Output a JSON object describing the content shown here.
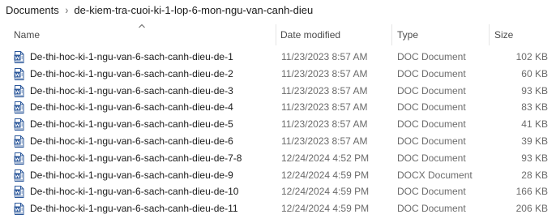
{
  "breadcrumb": {
    "items": [
      "Documents",
      "de-kiem-tra-cuoi-ki-1-lop-6-mon-ngu-van-canh-dieu"
    ],
    "separator": "›"
  },
  "columns": {
    "name": "Name",
    "date": "Date modified",
    "type": "Type",
    "size": "Size"
  },
  "colors": {
    "word_icon": "#2b579a"
  },
  "files": [
    {
      "name": "De-thi-hoc-ki-1-ngu-van-6-sach-canh-dieu-de-1",
      "date": "11/23/2023 8:57 AM",
      "type": "DOC Document",
      "size": "102 KB",
      "icon": "word-doc-icon"
    },
    {
      "name": "De-thi-hoc-ki-1-ngu-van-6-sach-canh-dieu-de-2",
      "date": "11/23/2023 8:57 AM",
      "type": "DOC Document",
      "size": "60 KB",
      "icon": "word-doc-icon"
    },
    {
      "name": "De-thi-hoc-ki-1-ngu-van-6-sach-canh-dieu-de-3",
      "date": "11/23/2023 8:57 AM",
      "type": "DOC Document",
      "size": "93 KB",
      "icon": "word-doc-icon"
    },
    {
      "name": "De-thi-hoc-ki-1-ngu-van-6-sach-canh-dieu-de-4",
      "date": "11/23/2023 8:57 AM",
      "type": "DOC Document",
      "size": "83 KB",
      "icon": "word-doc-icon"
    },
    {
      "name": "De-thi-hoc-ki-1-ngu-van-6-sach-canh-dieu-de-5",
      "date": "11/23/2023 8:57 AM",
      "type": "DOC Document",
      "size": "41 KB",
      "icon": "word-doc-icon"
    },
    {
      "name": "De-thi-hoc-ki-1-ngu-van-6-sach-canh-dieu-de-6",
      "date": "11/23/2023 8:57 AM",
      "type": "DOC Document",
      "size": "39 KB",
      "icon": "word-doc-icon"
    },
    {
      "name": "De-thi-hoc-ki-1-ngu-van-6-sach-canh-dieu-de-7-8",
      "date": "12/24/2024 4:52 PM",
      "type": "DOC Document",
      "size": "93 KB",
      "icon": "word-doc-icon"
    },
    {
      "name": "De-thi-hoc-ki-1-ngu-van-6-sach-canh-dieu-de-9",
      "date": "12/24/2024 4:59 PM",
      "type": "DOCX Document",
      "size": "28 KB",
      "icon": "word-docx-icon"
    },
    {
      "name": "De-thi-hoc-ki-1-ngu-van-6-sach-canh-dieu-de-10",
      "date": "12/24/2024 4:59 PM",
      "type": "DOC Document",
      "size": "166 KB",
      "icon": "word-doc-icon"
    },
    {
      "name": "De-thi-hoc-ki-1-ngu-van-6-sach-canh-dieu-de-11",
      "date": "12/24/2024 4:59 PM",
      "type": "DOC Document",
      "size": "206 KB",
      "icon": "word-doc-icon"
    }
  ]
}
